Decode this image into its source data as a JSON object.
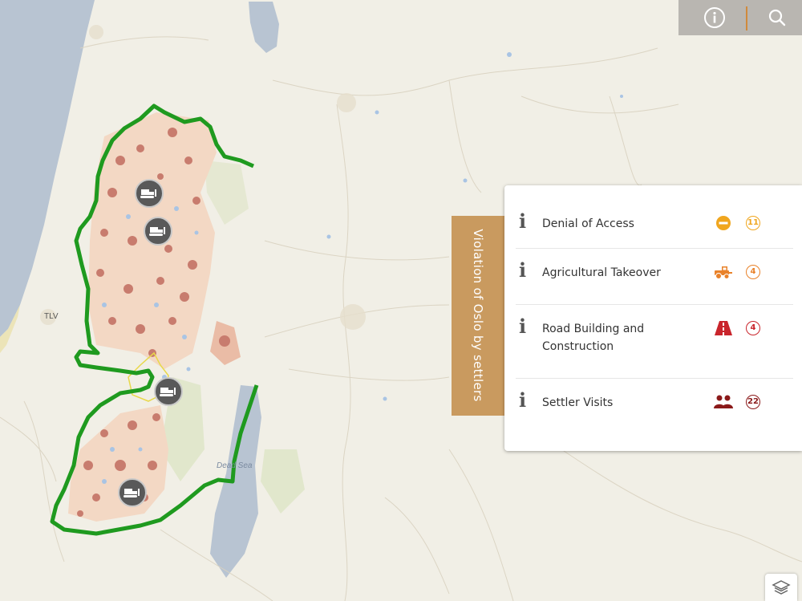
{
  "map": {
    "place_labels": [
      "TLV",
      "Dead Sea"
    ]
  },
  "toolbar": {
    "info_icon": "info-circle-icon",
    "search_icon": "search-icon"
  },
  "side_tab": {
    "label": "Violation of Oslo by settlers"
  },
  "panel": {
    "items": [
      {
        "label": "Denial of Access",
        "icon": "no-entry-icon",
        "count": "11",
        "color": "#f0a61e"
      },
      {
        "label": "Agricultural Takeover",
        "icon": "tractor-icon",
        "count": "4",
        "color": "#e9822a"
      },
      {
        "label": "Road Building and Construction",
        "icon": "road-icon",
        "count": "4",
        "color": "#c9252c"
      },
      {
        "label": "Settler Visits",
        "icon": "people-icon",
        "count": "22",
        "color": "#8b1a1a"
      }
    ]
  },
  "layers_button": {
    "icon": "layers-icon"
  }
}
